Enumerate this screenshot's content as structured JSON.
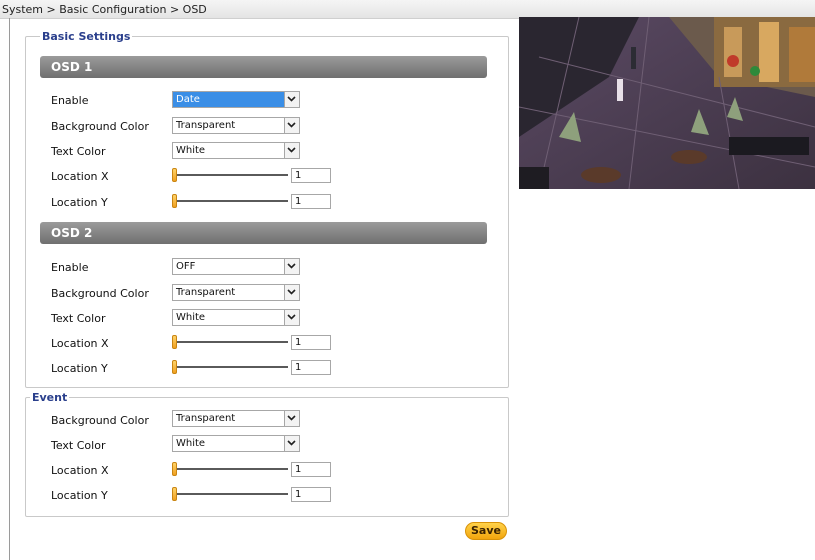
{
  "breadcrumb": "System > Basic Configuration > OSD",
  "basic_settings": {
    "legend": "Basic Settings",
    "osd1": {
      "title": "OSD 1",
      "labels": [
        "Enable",
        "Background Color",
        "Text Color",
        "Location X",
        "Location Y"
      ],
      "enable": "Date",
      "background_color": "Transparent",
      "text_color": "White",
      "location_x": "1",
      "location_y": "1"
    },
    "osd2": {
      "title": "OSD 2",
      "labels": [
        "Enable",
        "Background Color",
        "Text Color",
        "Location X",
        "Location Y"
      ],
      "enable": "OFF",
      "background_color": "Transparent",
      "text_color": "White",
      "location_x": "1",
      "location_y": "1"
    }
  },
  "event": {
    "legend": "Event",
    "labels": [
      "Background Color",
      "Text Color",
      "Location X",
      "Location Y"
    ],
    "background_color": "Transparent",
    "text_color": "White",
    "location_x": "1",
    "location_y": "1"
  },
  "save_label": "Save",
  "colors": {
    "accent": "#3a8ee6",
    "legend": "#2a3f8c",
    "save": "#f2a50d",
    "section_bar": "#7f7f7f"
  },
  "icons": {
    "dropdown": "chevron-down-icon"
  }
}
